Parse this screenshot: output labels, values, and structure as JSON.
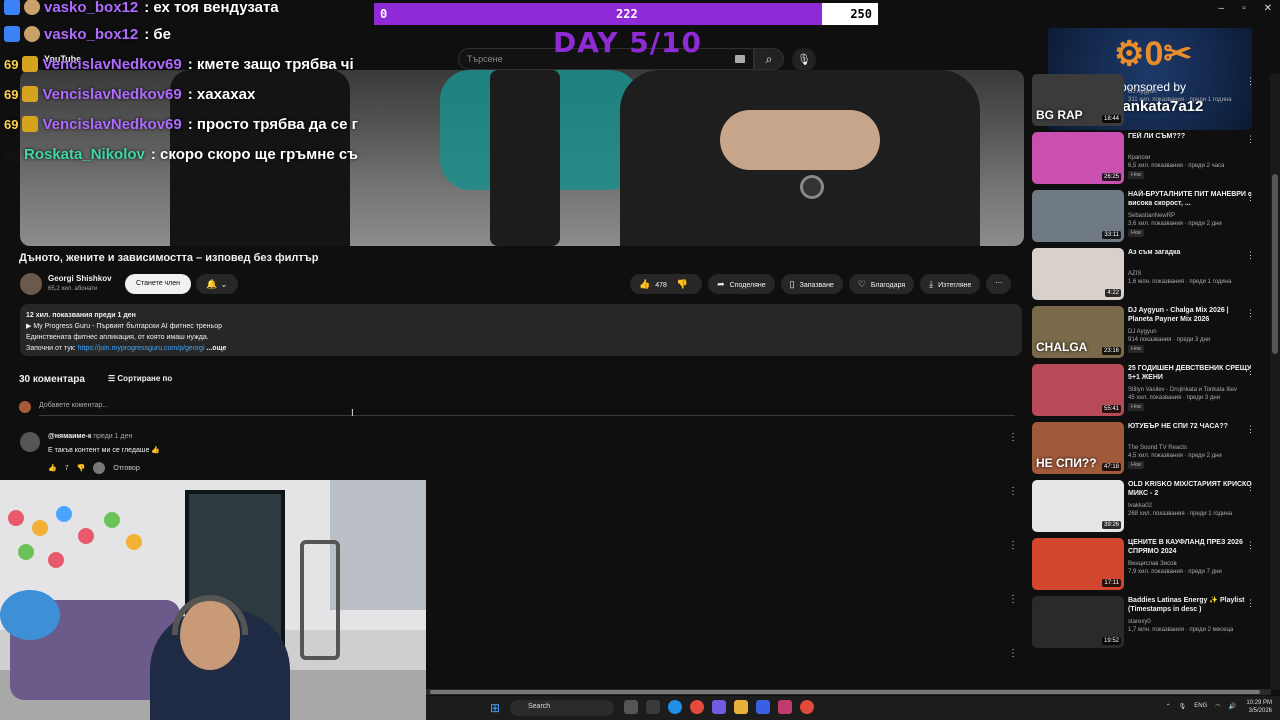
{
  "progress": {
    "min": "0",
    "current": "222",
    "max": "250",
    "fraction": 0.888,
    "color": "#8f2bd6"
  },
  "day_banner": "DAY 5/10",
  "youtube": {
    "logo_text": "YouTube",
    "search_placeholder": "Търсене"
  },
  "chat": [
    {
      "badge": "",
      "user": "vasko_box12",
      "text": ": ех тоя вендузата",
      "user_color": "#b06bff"
    },
    {
      "badge": "",
      "user": "vasko_box12",
      "text": ": бе",
      "user_color": "#b06bff"
    },
    {
      "badge": "69",
      "user": "VencislavNedkov69",
      "text": ": кмете защо трябва чі",
      "user_color": "#b06bff"
    },
    {
      "badge": "69",
      "user": "VencislavNedkov69",
      "text": ": хахахах",
      "user_color": "#b06bff"
    },
    {
      "badge": "69",
      "user": "VencislavNedkov69",
      "text": ": просто трябва да се г",
      "user_color": "#b06bff"
    },
    {
      "badge": "",
      "user": "Roskata_Nikolov",
      "text": ": скоро скоро ще гръмне съ",
      "user_color": "#3fd6a8"
    }
  ],
  "sponsor": {
    "by": "sponsored by",
    "name": "Juliankata7a12"
  },
  "video": {
    "title": "Дъното, жените и зависимостта – изповед без филтър",
    "channel": "Georgi Shishkov",
    "subscribers": "65,2 хил. абонати",
    "member_label": "Станете член",
    "likes": "478",
    "share": "Споделяне",
    "save": "Запазване",
    "thanks": "Благодаря",
    "download": "Изтегляне"
  },
  "description": {
    "meta": "12 хил. показвания  преди 1 ден",
    "line1": "▶ My Progress Guru - Първият български AI фитнес треньор",
    "line2": "Единствената фитнес апликация, от която имаш нужда.",
    "line3_prefix": "Започни от тук: ",
    "link": "https://join.myprogressguru.com/p/georgi",
    "more": "...още"
  },
  "comments": {
    "count": "30 коментара",
    "sort": "Сортиране по",
    "add_placeholder": "Добавете коментар...",
    "items": [
      {
        "author": "@нямаиме-к",
        "time": "преди 1 ден",
        "text": "Е такъв контент ми се гледаше 👍",
        "likes": "7",
        "reply": "Отговор"
      }
    ]
  },
  "recommendations": [
    {
      "title": "",
      "channel": "DJ Aygyun",
      "meta": "311 хил. показвания · преди 1 година",
      "duration": "18:44",
      "caption": "BG RAP",
      "thumb": "#3b3b3b",
      "new": ""
    },
    {
      "title": "ГЕЙ ЛИ СЪМ???",
      "channel": "Крапски",
      "meta": "6,5 хил. показвания · преди 2 часа",
      "duration": "26:25",
      "caption": "",
      "thumb": "#c94fb0",
      "new": "Нов"
    },
    {
      "title": "НАЙ-БРУТАЛНИТЕ ПИТ МАНЕВРИ с висока скорост, ...",
      "channel": "SebastianNewRP",
      "meta": "3,6 хил. показвания · преди 2 дни",
      "duration": "33:11",
      "caption": "",
      "thumb": "#6f7a84",
      "new": "Нов"
    },
    {
      "title": "Аз съм загадка",
      "channel": "AZIS",
      "meta": "1,6 млн. показвания · преди 1 година",
      "duration": "4:22",
      "caption": "",
      "thumb": "#d9d0cc",
      "new": ""
    },
    {
      "title": "DJ Aygyun - Chalga Mix 2026 | Planeta Payner Mix 2026",
      "channel": "DJ Aygyun",
      "meta": "914 показвания · преди 3 дни",
      "duration": "23:16",
      "caption": "CHALGA",
      "thumb": "#7a6a4a",
      "new": "Нов"
    },
    {
      "title": "25 ГОДИШЕН ДЕВСТВЕНИК СРЕЩУ 5+1 ЖЕНИ",
      "channel": "Stiliyn Vasilev - Drujinkata и Tonkata Iliev",
      "meta": "45 хил. показвания · преди 3 дни",
      "duration": "55:41",
      "caption": "",
      "thumb": "#b84a58",
      "new": "Нов"
    },
    {
      "title": "ЮТУБЪР НЕ СПИ 72 ЧАСА??",
      "channel": "The Sound TV Reacts",
      "meta": "4,5 хил. показвания · преди 2 дни",
      "duration": "47:18",
      "caption": "НЕ СПИ??",
      "thumb": "#a05a3a",
      "new": "Нов"
    },
    {
      "title": "OLD KRISKO MIX/СТАРИЯТ КРИСКО МИКС - 2",
      "channel": "Ivakka02",
      "meta": "268 хил. показвания · преди 1 година",
      "duration": "39:26",
      "caption": "",
      "thumb": "#e6e6e6",
      "new": ""
    },
    {
      "title": "ЦЕНИТЕ В КАУФЛАНД ПРЕЗ 2026 СПРЯМО 2024",
      "channel": "Венцислав Зисов",
      "meta": "7,9 хил. показвания · преди 7 дни",
      "duration": "17:11",
      "caption": "",
      "thumb": "#d2452f",
      "new": ""
    },
    {
      "title": "Baddies Latinas Energy ✨ Playlist (Timestamps in desc )",
      "channel": "starexy0",
      "meta": "1,7 млн. показвания · преди 2 месеца",
      "duration": "19:52",
      "caption": "",
      "thumb": "#2a2a2a",
      "new": ""
    }
  ],
  "taskbar": {
    "search": "Search",
    "lang": "ENG",
    "time": "10:29 PM",
    "date": "3/5/2026"
  }
}
